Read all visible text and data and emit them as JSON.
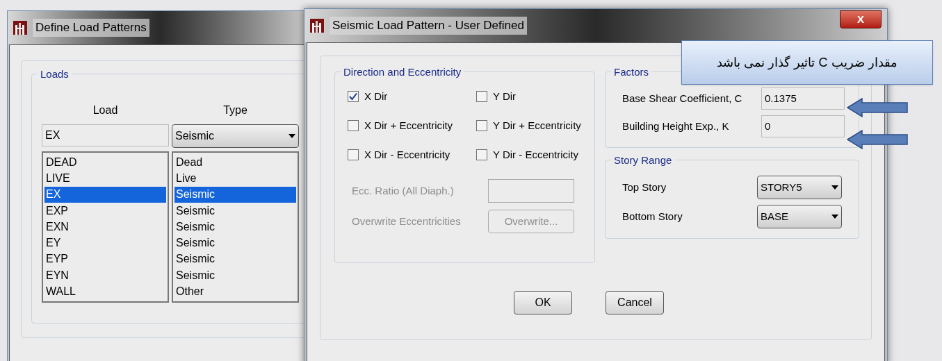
{
  "back_window": {
    "title": "Define Load Patterns",
    "group_title": "Loads",
    "columns": [
      "Load",
      "Type"
    ],
    "load_input": {
      "value": "EX"
    },
    "type_select": {
      "value": "Seismic"
    },
    "rows": [
      {
        "load": "DEAD",
        "type": "Dead",
        "selected": false
      },
      {
        "load": "LIVE",
        "type": "Live",
        "selected": false
      },
      {
        "load": "EX",
        "type": "Seismic",
        "selected": true
      },
      {
        "load": "EXP",
        "type": "Seismic",
        "selected": false
      },
      {
        "load": "EXN",
        "type": "Seismic",
        "selected": false
      },
      {
        "load": "EY",
        "type": "Seismic",
        "selected": false
      },
      {
        "load": "EYP",
        "type": "Seismic",
        "selected": false
      },
      {
        "load": "EYN",
        "type": "Seismic",
        "selected": false
      },
      {
        "load": "WALL",
        "type": "Other",
        "selected": false
      }
    ]
  },
  "dialog": {
    "title": "Seismic Load Pattern - User Defined",
    "close_label": "X",
    "direction": {
      "title": "Direction and Eccentricity",
      "options": [
        {
          "label": "X Dir",
          "checked": true
        },
        {
          "label": "Y Dir",
          "checked": false
        },
        {
          "label": "X Dir + Eccentricity",
          "checked": false
        },
        {
          "label": "Y Dir + Eccentricity",
          "checked": false
        },
        {
          "label": "X Dir - Eccentricity",
          "checked": false
        },
        {
          "label": "Y Dir - Eccentricity",
          "checked": false
        }
      ],
      "ecc_ratio": {
        "label": "Ecc. Ratio (All Diaph.)",
        "disabled": true
      },
      "overwrite": {
        "label": "Overwrite Eccentricities",
        "button": "Overwrite...",
        "disabled": true
      }
    },
    "factors": {
      "title": "Factors",
      "fields": [
        {
          "label": "Base Shear Coefficient, C",
          "value": "0.1375"
        },
        {
          "label": "Building Height Exp., K",
          "value": "0"
        }
      ]
    },
    "story_range": {
      "title": "Story Range",
      "fields": [
        {
          "label": "Top Story",
          "value": "STORY5"
        },
        {
          "label": "Bottom Story",
          "value": "BASE"
        }
      ]
    },
    "buttons": [
      "OK",
      "Cancel"
    ]
  },
  "callout": {
    "text": "مقدار ضریب C تاثیر گذار نمی باشد"
  }
}
